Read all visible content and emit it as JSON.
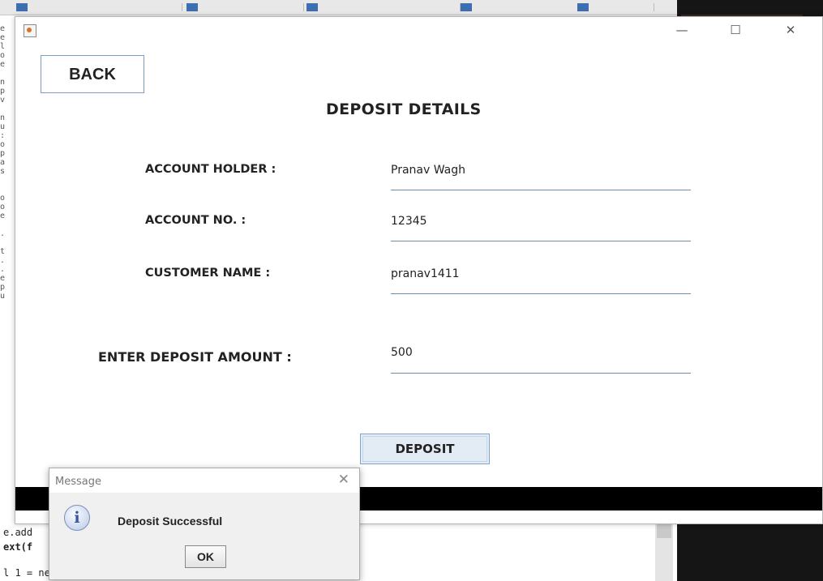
{
  "window": {
    "minimize_glyph": "—",
    "maximize_glyph": "☐",
    "close_glyph": "✕"
  },
  "back_button": {
    "label": "BACK"
  },
  "heading": "DEPOSIT DETAILS",
  "fields": {
    "account_holder": {
      "label": "ACCOUNT HOLDER :",
      "value": "Pranav Wagh"
    },
    "account_no": {
      "label": "ACCOUNT NO. :",
      "value": "12345"
    },
    "customer_name": {
      "label": "CUSTOMER NAME :",
      "value": "pranav1411"
    },
    "deposit_amount": {
      "label": "ENTER DEPOSIT AMOUNT :",
      "value": "500"
    }
  },
  "deposit_button": {
    "label": "DEPOSIT"
  },
  "dialog": {
    "title": "Message",
    "icon": "info-icon",
    "icon_glyph": "i",
    "close_glyph": "✕",
    "message": "Deposit Successful",
    "ok_label": "OK"
  },
  "background_code": {
    "line1": "e.add",
    "line2": "ext(f",
    "line3": "l 1 = new JLabel(\"\");"
  },
  "colors": {
    "underline": "#6d8db3",
    "button_border": "#7fa5cf",
    "black_bar": "#000000"
  }
}
